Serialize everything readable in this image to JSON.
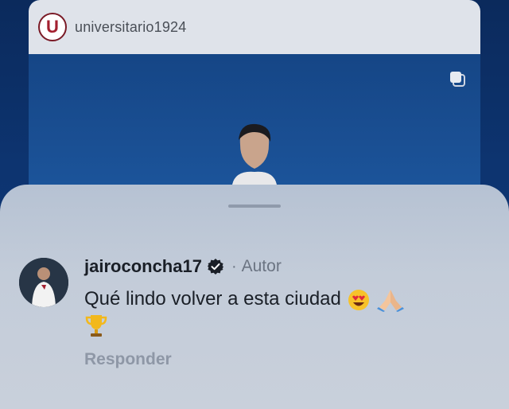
{
  "post": {
    "username": "universitario1924",
    "logo_letter": "U"
  },
  "comment": {
    "username": "jairoconcha17",
    "separator": "·",
    "author_label": "Autor",
    "text": "Qué lindo volver a esta ciudad",
    "emojis": [
      "heart-eyes-emoji",
      "folded-hands-emoji",
      "trophy-emoji"
    ],
    "reply_label": "Responder"
  },
  "colors": {
    "background": "#0d3470",
    "sheet": "#c3ccd9",
    "text": "#1a1f27",
    "muted": "#8e97a6",
    "brand": "#a3202f"
  }
}
